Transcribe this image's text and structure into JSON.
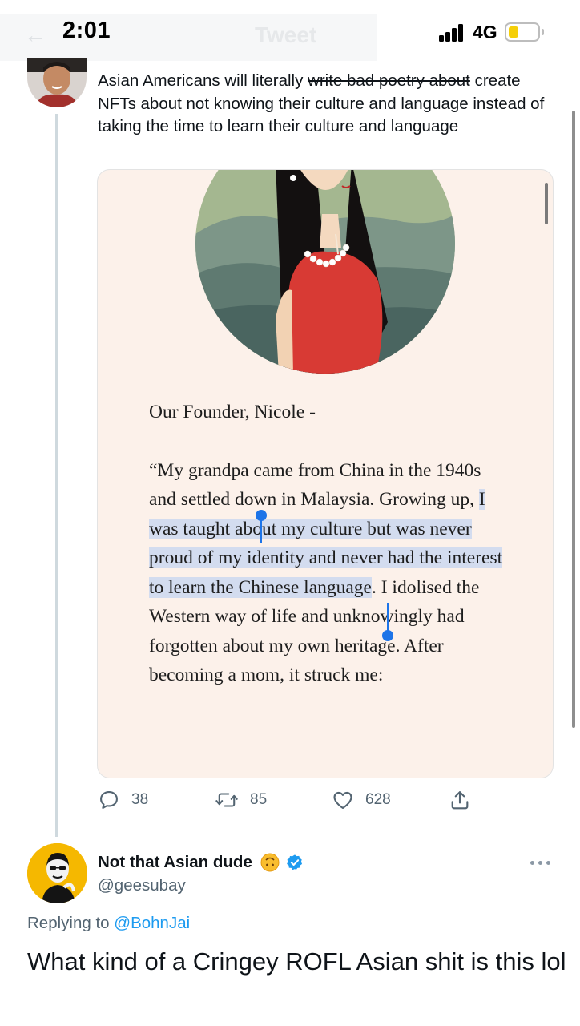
{
  "status_bar": {
    "time": "2:01",
    "network": "4G",
    "ghost_back": "←",
    "ghost_title": "Tweet"
  },
  "quoted_tweet": {
    "text_before": "Asian Americans will literally ",
    "struck_text": "write bad poetry about",
    "text_after": " create NFTs about not knowing their culture and language instead of taking the time to learn their culture and language",
    "media": {
      "founder_heading": "Our Founder, Nicole -",
      "quote_part1": "“My grandpa came from China in the 1940s and settled down in Malaysia. Growing up, ",
      "quote_selected": "I was taught about my culture but was never proud of my identity and never had the interest to learn the Chinese language",
      "quote_part2": ". I idolised the Western way of life and unknowingly had forgotten about my own heritage. After becoming a mom, it struck me:"
    },
    "actions": {
      "reply_count": "38",
      "retweet_count": "85",
      "like_count": "628"
    },
    "icons": [
      "reply-icon",
      "retweet-icon",
      "like-icon",
      "share-icon"
    ]
  },
  "reply": {
    "author_name": "Not that Asian dude",
    "author_handle": "@geesubay",
    "replying_prefix": "Replying to",
    "replying_to": "@BohnJai",
    "text": "What kind of a Cringey ROFL Asian shit is this lol"
  },
  "colors": {
    "text": "#0f1419",
    "muted": "#536471",
    "link": "#1d9bf0",
    "selection": "#d3dcef",
    "selection_handle": "#1d74e8",
    "card_bg": "#fcf1ea"
  }
}
